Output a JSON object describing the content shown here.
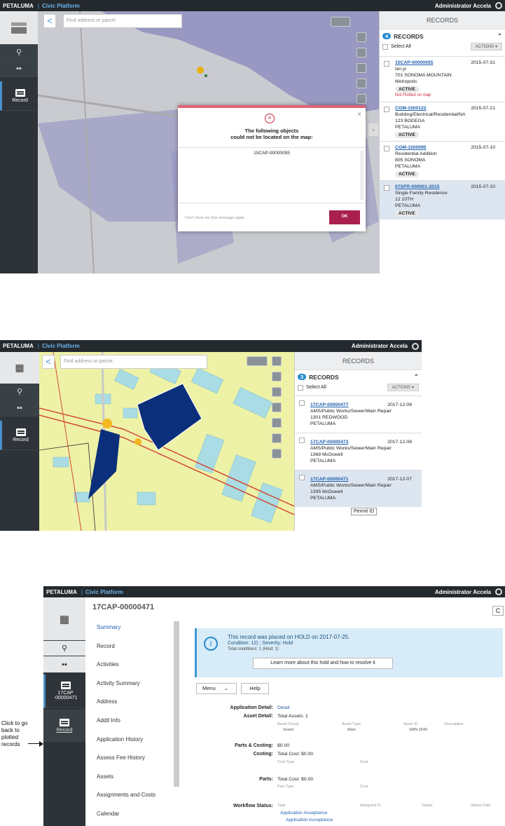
{
  "shot1": {
    "header": {
      "brand": "PETALUMA",
      "separator": "|",
      "app": "Civic Platform",
      "user": "Administrator Accela"
    },
    "search": {
      "placeholder": "Find address or parcel"
    },
    "panel": {
      "title": "RECORDS",
      "count": "4",
      "records_label": "RECORDS",
      "select_all": "Select All",
      "actions": "ACTIONS ▾"
    },
    "records": [
      {
        "id": "15CAP-00000055",
        "date": "2015-07-31",
        "lines": [
          "lan.yi",
          "701 SONOMA MOUNTAIN",
          "Metropolis"
        ],
        "status": "ACTIVE",
        "note": "Not Plotted on map"
      },
      {
        "id": "COM-1500122",
        "date": "2015-07-21",
        "lines": [
          "Building/Electrical/Residential/NA",
          "123 BODEGA",
          "PETALUMA"
        ],
        "status": "ACTIVE",
        "note": ""
      },
      {
        "id": "COM-1500095",
        "date": "2015-07-10",
        "lines": [
          "Residential Addition",
          "805 SONOMA",
          "PETALUMA"
        ],
        "status": "ACTIVE",
        "note": ""
      },
      {
        "id": "07SFR-000001-2015",
        "date": "2015-07-10",
        "lines": [
          "Single Family Residence",
          "12 10TH",
          "PETALUMA"
        ],
        "status": "ACTIVE",
        "note": ""
      }
    ],
    "modal": {
      "title_line1": "The following objects",
      "title_line2": "could not be located on the map:",
      "item": "15CAP-00000055",
      "checkbox": "Don't show me this message again",
      "ok": "OK"
    },
    "nav": {
      "record": "Record"
    }
  },
  "shot2": {
    "header": {
      "brand": "PETALUMA",
      "separator": "|",
      "app": "Civic Platform",
      "user": "Administrator Accela"
    },
    "search": {
      "placeholder": "Find address or parcel"
    },
    "panel": {
      "title": "RECORDS",
      "count": "3",
      "records_label": "RECORDS",
      "select_all": "Select All",
      "actions": "ACTIONS ▾"
    },
    "records": [
      {
        "id": "17CAP-00000477",
        "date": "2017-12-08",
        "lines": [
          "AMS/Public Works/Sewer/Main Repair",
          "1301 REDWOOD",
          "PETALUMA"
        ]
      },
      {
        "id": "17CAP-00000473",
        "date": "2017-12-08",
        "lines": [
          "AMS/Public Works/Sewer/Main Repair",
          "1368 McDowell",
          "PETALUMA"
        ]
      },
      {
        "id": "17CAP-00000471",
        "date": "2017-12-07",
        "lines": [
          "AMS/Public Works/Sewer/Main Repair",
          "1395 McDowell",
          "PETALUMA"
        ]
      }
    ],
    "tooltip": "Permit ID",
    "nav": {
      "record": "Record"
    }
  },
  "shot3": {
    "header": {
      "brand": "PETALUMA",
      "separator": "|",
      "app": "Civic Platform",
      "user": "Administrator Accela"
    },
    "record_title": "17CAP-00000471",
    "nav": {
      "record_id_line1": "17CAP",
      "record_id_line2": "-00000471",
      "record": "Record"
    },
    "callout": "Click to go back to plotted records",
    "menu": [
      "Summary",
      "Record",
      "Activities",
      "Activity Summary",
      "Address",
      "Addtl Info",
      "Application History",
      "Assess Fee History",
      "Assets",
      "Assignments and Costs",
      "Calendar"
    ],
    "hold": {
      "line1": "This record was placed on HOLD on 2017-07-25.",
      "line2": "Condition: 12) ; Severity: Hold",
      "line3": "Total conditions: 1  (Hold: 1)",
      "button": "Learn more about this hold and how to resolve it"
    },
    "toolbar": {
      "menu": "Menu",
      "help": "Help"
    },
    "detail": {
      "app_label": "Application Detail:",
      "app_val": "Detail",
      "asset_label": "Asset Detail:",
      "asset_val": "Total Assets: 1",
      "asset_cols": [
        "Asset Group",
        "Asset Type",
        "Asset ID",
        "Description"
      ],
      "asset_row": [
        "Sewer",
        "Main",
        "SMN 2640",
        ""
      ],
      "parts_costing_label": "Parts & Costing:",
      "parts_costing_val": "$0.00",
      "costing_label": "Costing:",
      "costing_val": "Total Cost: $0.00",
      "cost_cols": [
        "Cost Type",
        "Cost"
      ],
      "parts_label": "Parts:",
      "parts_val": "Total Cost: $0.00",
      "part_cols": [
        "Part Type",
        "Cost"
      ],
      "workflow_label": "Workflow Status:",
      "wf_cols": [
        "Task",
        "Assigned To",
        "Status",
        "Status Date"
      ],
      "wf_rows": [
        "Application Acceptance",
        "Application Acceptance"
      ]
    }
  }
}
